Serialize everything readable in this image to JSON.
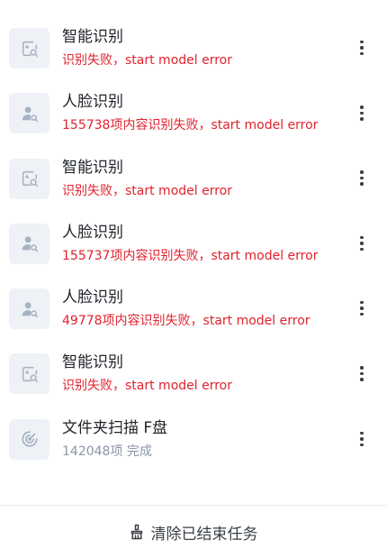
{
  "colors": {
    "error_text": "#e0222e",
    "muted_text": "#8a94a6",
    "title_text": "#1f2329",
    "icon_bg": "#eef2f7",
    "icon_fg": "#a7b2c3"
  },
  "tasks": [
    {
      "icon": "image-search-icon",
      "title": "智能识别",
      "status": "识别失败，start model error",
      "status_type": "error"
    },
    {
      "icon": "person-search-icon",
      "title": "人脸识别",
      "status": "155738项内容识别失败，start model error",
      "status_type": "error"
    },
    {
      "icon": "image-search-icon",
      "title": "智能识别",
      "status": "识别失败，start model error",
      "status_type": "error"
    },
    {
      "icon": "person-search-icon",
      "title": "人脸识别",
      "status": "155737项内容识别失败，start model error",
      "status_type": "error"
    },
    {
      "icon": "person-search-icon",
      "title": "人脸识别",
      "status": "49778项内容识别失败，start model error",
      "status_type": "error"
    },
    {
      "icon": "image-search-icon",
      "title": "智能识别",
      "status": "识别失败，start model error",
      "status_type": "error"
    },
    {
      "icon": "radar-scan-icon",
      "title": "文件夹扫描 F盘",
      "status": "142048项 完成",
      "status_type": "done"
    }
  ],
  "footer": {
    "icon": "broom-icon",
    "clear_label": "清除已结束任务"
  }
}
